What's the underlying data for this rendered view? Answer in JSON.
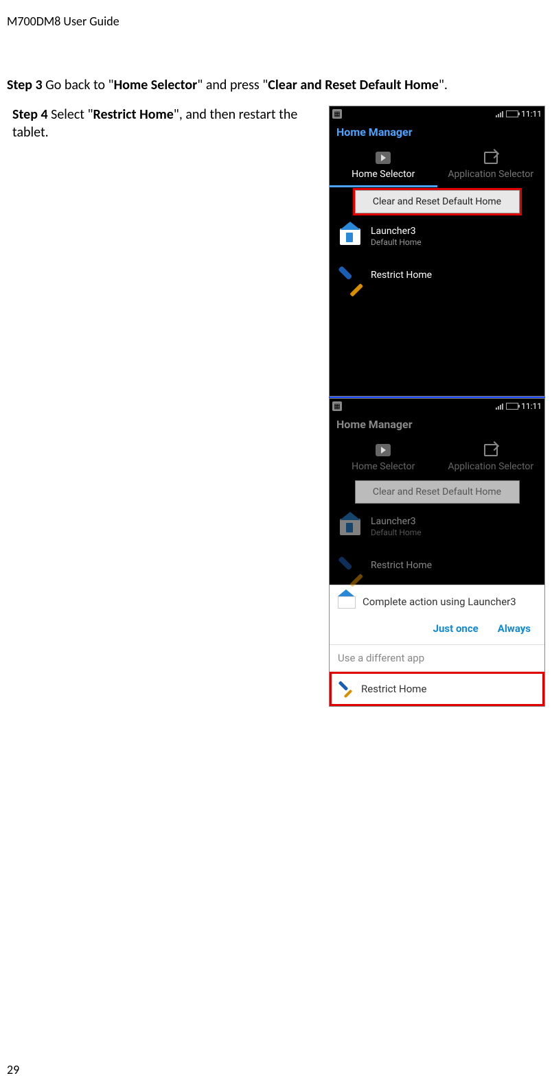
{
  "doc": {
    "header": "M700DM8 User Guide",
    "page_number": "29",
    "step3_prefix": "Step 3",
    "step3_t1": " Go back to \"",
    "step3_b1": "Home Selector",
    "step3_t2": "\" and press \"",
    "step3_b2": "Clear and Reset Default Home",
    "step3_t3": "\".",
    "step4_prefix": "Step 4",
    "step4_t1": " Select \"",
    "step4_b1": "Restrict Home",
    "step4_t2": "\", and then restart the tablet."
  },
  "shot1": {
    "time": "11:11",
    "app_title": "Home Manager",
    "tab_home": "Home Selector",
    "tab_app": "Application Selector",
    "clear_btn": "Clear and Reset Default Home",
    "launcher1_title": "Launcher3",
    "launcher1_sub": "Default Home",
    "launcher2_title": "Restrict Home"
  },
  "shot2": {
    "time": "11:11",
    "app_title": "Home Manager",
    "tab_home": "Home Selector",
    "tab_app": "Application Selector",
    "clear_btn": "Clear and Reset Default Home",
    "launcher1_title": "Launcher3",
    "launcher1_sub": "Default Home",
    "launcher2_title": "Restrict Home",
    "chooser_title": "Complete action using Launcher3",
    "just_once": "Just once",
    "always": "Always",
    "diff_app": "Use a different app",
    "restrict": "Restrict Home"
  }
}
